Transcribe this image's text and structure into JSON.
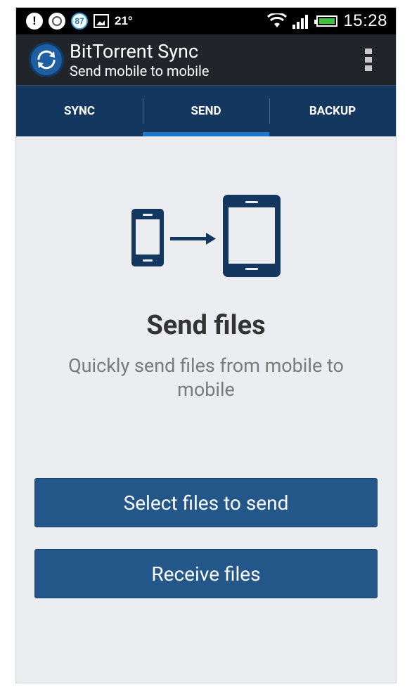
{
  "status_bar": {
    "temperature": "21°",
    "badge_number": "87",
    "time": "15:28",
    "battery_color": "#3fc23a"
  },
  "action_bar": {
    "title": "BitTorrent Sync",
    "subtitle": "Send mobile to mobile",
    "logo_icon": "bittorrent-sync-logo"
  },
  "tabs": [
    {
      "label": "SYNC",
      "active": false
    },
    {
      "label": "SEND",
      "active": true
    },
    {
      "label": "BACKUP",
      "active": false
    }
  ],
  "content": {
    "illustration_icon": "phone-to-tablet-transfer",
    "heading": "Send files",
    "description": "Quickly send files from mobile to mobile",
    "select_button": "Select files to send",
    "receive_button": "Receive files"
  },
  "colors": {
    "accent": "#1f76c8",
    "tab_bar": "#13375e",
    "button": "#235689",
    "background": "#ecedf1"
  }
}
